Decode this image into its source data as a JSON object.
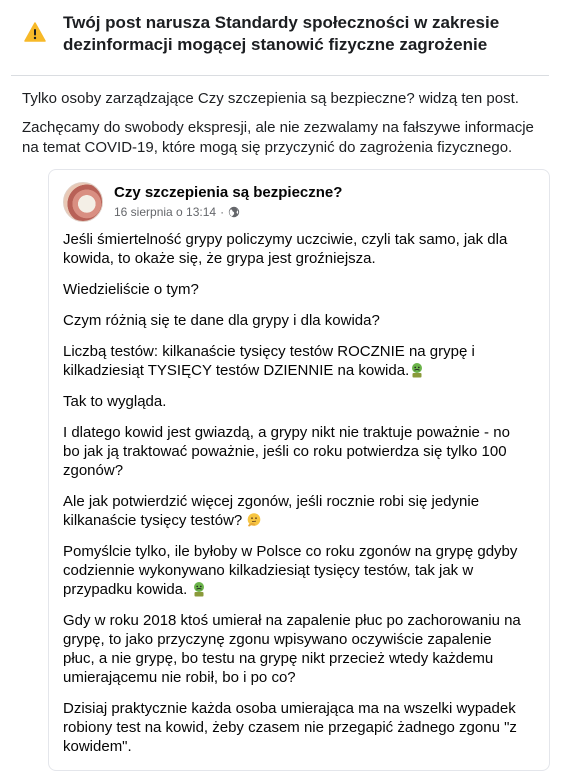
{
  "header": {
    "title": "Twój post narusza Standardy społeczności w zakresie dezinformacji mogącej stanowić fizyczne zagrożenie",
    "icon": "warning-icon",
    "icon_color": "#f7b928"
  },
  "info": {
    "line1": "Tylko osoby zarządzające Czy szczepienia są bezpieczne? widzą ten post.",
    "line2": "Zachęcamy do swobody ekspresji, ale nie zezwalamy na fałszywe informacje na temat COVID-19, które mogą się przyczynić do zagrożenia fizycznego."
  },
  "post": {
    "author": "Czy szczepienia są bezpieczne?",
    "date": "16 sierpnia o 13:14",
    "separator": "·",
    "audience_icon": "globe-icon",
    "paragraphs": [
      "Jeśli śmiertelność grypy policzymy uczciwie, czyli tak samo, jak dla kowida, to okaże się, że grypa jest groźniejsza.",
      "Wiedzieliście o tym?",
      "Czym różnią się te dane dla grypy i dla kowida?",
      "Liczbą testów: kilkanaście tysięcy testów ROCZNIE na grypę i kilkadziesiąt TYSIĘCY testów DZIENNIE na kowida.",
      "Tak to wygląda.",
      "I dlatego kowid jest gwiazdą, a grypy nikt nie traktuje poważnie - no bo jak ją traktować poważnie, jeśli co roku potwierdza się tylko 100 zgonów?",
      "Ale jak potwierdzić więcej zgonów, jeśli rocznie robi się jedynie kilkanaście tysięcy testów?",
      "Pomyślcie tylko, ile byłoby w Polsce co roku zgonów na grypę gdyby codziennie wykonywano kilkadziesiąt tysięcy testów, tak jak w przypadku kowida.",
      "Gdy w roku 2018 ktoś umierał na zapalenie płuc po zachorowaniu na grypę, to jako przyczynę zgonu wpisywano oczywiście zapalenie płuc, a nie grypę, bo testu na grypę nikt przecież wtedy każdemu umierającemu nie robił, bo i po co?",
      "Dzisiaj praktycznie każda osoba umierająca ma na wszelki wypadek robiony test na kowid, żeby czasem nie przegapić żadnego zgonu \"z kowidem\"."
    ],
    "emojis": {
      "p3": "nauseated-face-emoji",
      "p6": "thinking-face-emoji",
      "p7": "nauseated-face-emoji"
    }
  }
}
